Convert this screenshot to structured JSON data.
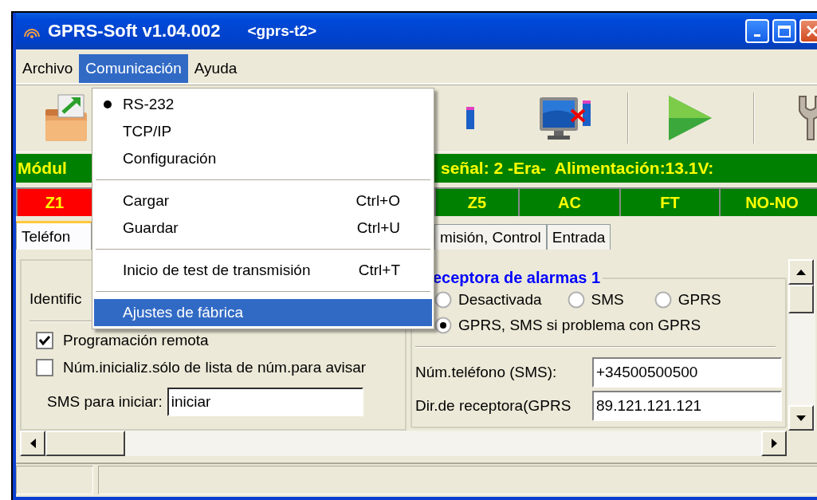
{
  "window": {
    "title": "GPRS-Soft v1.04.002",
    "subtitle": "<gprs-t2>"
  },
  "menu_bar": [
    {
      "label": "Archivo",
      "selected": false
    },
    {
      "label": "Comunicación",
      "selected": true
    },
    {
      "label": "Ayuda",
      "selected": false
    }
  ],
  "info_bar": {
    "left": "Módul",
    "right": "señal: 2 -Era-  Alimentación:13.1V:"
  },
  "zones": [
    {
      "label": "Z1",
      "color": "#ff0000"
    },
    {
      "label": "Z5",
      "color": "#008000"
    },
    {
      "label": "AC",
      "color": "#008000"
    },
    {
      "label": "FT",
      "color": "#008000"
    },
    {
      "label": "NO-NO",
      "color": "#008000"
    }
  ],
  "tabs": [
    {
      "label": "Teléfon",
      "selected": true
    },
    {
      "label": "misión, Control",
      "selected": false
    },
    {
      "label": "Entrada",
      "selected": false
    }
  ],
  "phone_panel": {
    "label": "Identific",
    "checkboxes": [
      {
        "label": "Programación remota",
        "checked": true
      },
      {
        "label": "Núm.inicializ.sólo de lista de núm.para avisar",
        "checked": false
      }
    ],
    "sms_field": {
      "label": "SMS para iniciar:",
      "value": "iniciar"
    }
  },
  "receiver_panel": {
    "title": "eceptora de alarmas 1",
    "radios": [
      {
        "label": "Desactivada",
        "selected": false
      },
      {
        "label": "SMS",
        "selected": false
      },
      {
        "label": "GPRS",
        "selected": false
      },
      {
        "label": "GPRS, SMS si problema con GPRS",
        "selected": true
      }
    ],
    "fields": [
      {
        "label": "Núm.teléfono (SMS):",
        "value": "+34500500500"
      },
      {
        "label": "Dir.de receptora(GPRS",
        "value": "89.121.121.121"
      }
    ]
  },
  "dropdown": {
    "items": [
      {
        "kind": "radio",
        "label": "RS-232",
        "checked": true,
        "highlighted": false
      },
      {
        "kind": "item",
        "label": "TCP/IP",
        "highlighted": false
      },
      {
        "kind": "item",
        "label": "Configuración",
        "highlighted": false
      },
      {
        "kind": "separator"
      },
      {
        "kind": "item",
        "label": "Cargar",
        "shortcut": "Ctrl+O",
        "highlighted": false
      },
      {
        "kind": "item",
        "label": "Guardar",
        "shortcut": "Ctrl+U",
        "highlighted": false
      },
      {
        "kind": "separator"
      },
      {
        "kind": "item",
        "label": "Inicio de test de transmisión",
        "shortcut": "Ctrl+T",
        "highlighted": false
      },
      {
        "kind": "separator"
      },
      {
        "kind": "item",
        "label": "Ajustes de fábrica",
        "highlighted": true
      }
    ]
  }
}
